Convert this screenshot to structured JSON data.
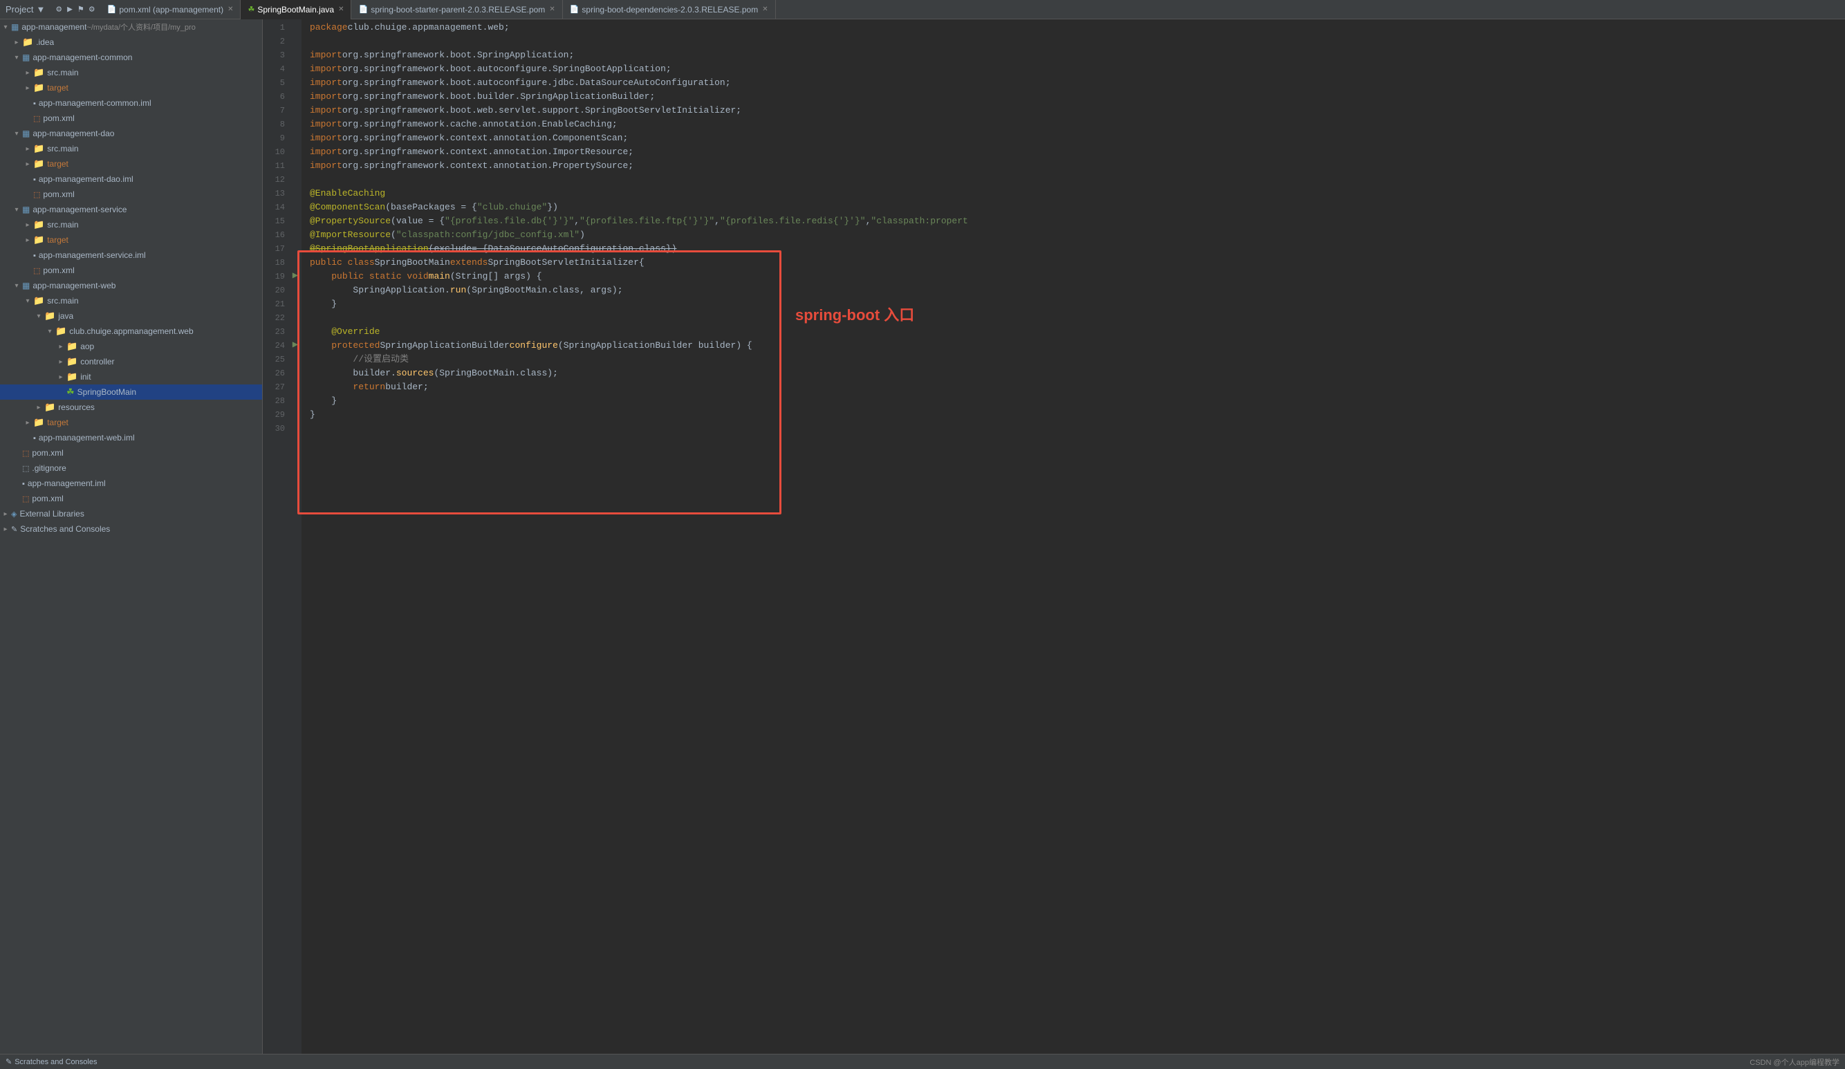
{
  "topbar": {
    "project_label": "Project",
    "dropdown_icon": "▼"
  },
  "tabs": [
    {
      "id": "pom-xml",
      "label": "pom.xml (app-management)",
      "active": false,
      "closable": true
    },
    {
      "id": "springbootmain",
      "label": "SpringBootMain.java",
      "active": true,
      "closable": true
    },
    {
      "id": "spring-boot-starter",
      "label": "spring-boot-starter-parent-2.0.3.RELEASE.pom",
      "active": false,
      "closable": true
    },
    {
      "id": "spring-boot-deps",
      "label": "spring-boot-dependencies-2.0.3.RELEASE.pom",
      "active": false,
      "closable": true
    }
  ],
  "sidebar": {
    "items": [
      {
        "level": 0,
        "type": "module-root",
        "label": "app-management",
        "suffix": " ~/mydata/个人资料/项目/my_pro",
        "expanded": true,
        "icon": "module"
      },
      {
        "level": 1,
        "type": "folder",
        "label": ".idea",
        "expanded": false,
        "icon": "folder"
      },
      {
        "level": 1,
        "type": "module",
        "label": "app-management-common",
        "expanded": true,
        "icon": "module"
      },
      {
        "level": 2,
        "type": "folder-src",
        "label": "src.main",
        "expanded": false,
        "icon": "folder-src"
      },
      {
        "level": 2,
        "type": "folder-target",
        "label": "target",
        "expanded": false,
        "icon": "folder-target"
      },
      {
        "level": 2,
        "type": "file-iml",
        "label": "app-management-common.iml",
        "icon": "iml"
      },
      {
        "level": 2,
        "type": "file-xml",
        "label": "pom.xml",
        "icon": "xml"
      },
      {
        "level": 1,
        "type": "module",
        "label": "app-management-dao",
        "expanded": true,
        "icon": "module"
      },
      {
        "level": 2,
        "type": "folder-src",
        "label": "src.main",
        "expanded": false,
        "icon": "folder-src"
      },
      {
        "level": 2,
        "type": "folder-target",
        "label": "target",
        "expanded": false,
        "icon": "folder-target"
      },
      {
        "level": 2,
        "type": "file-iml",
        "label": "app-management-dao.iml",
        "icon": "iml"
      },
      {
        "level": 2,
        "type": "file-xml",
        "label": "pom.xml",
        "icon": "xml"
      },
      {
        "level": 1,
        "type": "module",
        "label": "app-management-service",
        "expanded": true,
        "icon": "module"
      },
      {
        "level": 2,
        "type": "folder-src",
        "label": "src.main",
        "expanded": false,
        "icon": "folder-src"
      },
      {
        "level": 2,
        "type": "folder-target",
        "label": "target",
        "expanded": false,
        "icon": "folder-target"
      },
      {
        "level": 2,
        "type": "file-iml",
        "label": "app-management-service.iml",
        "icon": "iml"
      },
      {
        "level": 2,
        "type": "file-xml",
        "label": "pom.xml",
        "icon": "xml"
      },
      {
        "level": 1,
        "type": "module",
        "label": "app-management-web",
        "expanded": true,
        "icon": "module"
      },
      {
        "level": 2,
        "type": "folder-src",
        "label": "src.main",
        "expanded": true,
        "icon": "folder-src"
      },
      {
        "level": 3,
        "type": "folder",
        "label": "java",
        "expanded": true,
        "icon": "folder"
      },
      {
        "level": 4,
        "type": "package",
        "label": "club.chuige.appmanagement.web",
        "expanded": true,
        "icon": "folder"
      },
      {
        "level": 5,
        "type": "folder",
        "label": "aop",
        "expanded": false,
        "icon": "folder"
      },
      {
        "level": 5,
        "type": "folder",
        "label": "controller",
        "expanded": false,
        "icon": "folder"
      },
      {
        "level": 5,
        "type": "folder",
        "label": "init",
        "expanded": false,
        "icon": "folder"
      },
      {
        "level": 5,
        "type": "file-class",
        "label": "SpringBootMain",
        "icon": "spring",
        "selected": true
      },
      {
        "level": 3,
        "type": "folder",
        "label": "resources",
        "expanded": false,
        "icon": "folder"
      },
      {
        "level": 2,
        "type": "folder-target",
        "label": "target",
        "expanded": false,
        "icon": "folder-target"
      },
      {
        "level": 2,
        "type": "file-iml",
        "label": "app-management-web.iml",
        "icon": "iml"
      },
      {
        "level": 1,
        "type": "file-xml",
        "label": "pom.xml",
        "icon": "xml"
      },
      {
        "level": 1,
        "type": "file-git",
        "label": ".gitignore",
        "icon": "git"
      },
      {
        "level": 1,
        "type": "file-iml",
        "label": "app-management.iml",
        "icon": "iml"
      },
      {
        "level": 1,
        "type": "file-xml",
        "label": "pom.xml",
        "icon": "xml"
      }
    ],
    "external_libraries": "External Libraries",
    "scratches": "Scratches and Consoles"
  },
  "code": {
    "lines": [
      {
        "num": 1,
        "content": "package club.chuige.appmanagement.web;"
      },
      {
        "num": 2,
        "content": ""
      },
      {
        "num": 3,
        "content": "import org.springframework.boot.SpringApplication;"
      },
      {
        "num": 4,
        "content": "import org.springframework.boot.autoconfigure.SpringBootApplication;"
      },
      {
        "num": 5,
        "content": "import org.springframework.boot.autoconfigure.jdbc.DataSourceAutoConfiguration;"
      },
      {
        "num": 6,
        "content": "import org.springframework.boot.builder.SpringApplicationBuilder;"
      },
      {
        "num": 7,
        "content": "import org.springframework.boot.web.servlet.support.SpringBootServletInitializer;"
      },
      {
        "num": 8,
        "content": "import org.springframework.cache.annotation.EnableCaching;"
      },
      {
        "num": 9,
        "content": "import org.springframework.context.annotation.ComponentScan;"
      },
      {
        "num": 10,
        "content": "import org.springframework.context.annotation.ImportResource;"
      },
      {
        "num": 11,
        "content": "import org.springframework.context.annotation.PropertySource;"
      },
      {
        "num": 12,
        "content": ""
      },
      {
        "num": 13,
        "content": "@EnableCaching"
      },
      {
        "num": 14,
        "content": "@ComponentScan(basePackages = {\"club.chuige\"})"
      },
      {
        "num": 15,
        "content": "@PropertySource(value = {\"${profiles.file.db}\",\"${profiles.file.ftp}\",\"${profiles.file.redis}\",\"classpath:propert"
      },
      {
        "num": 16,
        "content": "@ImportResource(\"classpath:config/jdbc_config.xml\")"
      },
      {
        "num": 17,
        "content": "@SpringBootApplication(exclude= {DataSourceAutoConfiguration.class})"
      },
      {
        "num": 18,
        "content": "public class SpringBootMain extends SpringBootServletInitializer {"
      },
      {
        "num": 19,
        "content": "    public static void main(String[] args) {"
      },
      {
        "num": 20,
        "content": "        SpringApplication.run(SpringBootMain.class, args);"
      },
      {
        "num": 21,
        "content": "    }"
      },
      {
        "num": 22,
        "content": ""
      },
      {
        "num": 23,
        "content": "    @Override"
      },
      {
        "num": 24,
        "content": "    protected SpringApplicationBuilder configure(SpringApplicationBuilder builder) {"
      },
      {
        "num": 25,
        "content": "        //设置启动类"
      },
      {
        "num": 26,
        "content": "        builder.sources(SpringBootMain.class);"
      },
      {
        "num": 27,
        "content": "        return builder;"
      },
      {
        "num": 28,
        "content": "    }"
      },
      {
        "num": 29,
        "content": "}"
      },
      {
        "num": 30,
        "content": ""
      }
    ]
  },
  "annotation": {
    "label": "spring-boot 入口"
  },
  "bottom_bar": {
    "scratches_label": "Scratches and Consoles",
    "right_text": "CSDN @个人app编程教学"
  }
}
